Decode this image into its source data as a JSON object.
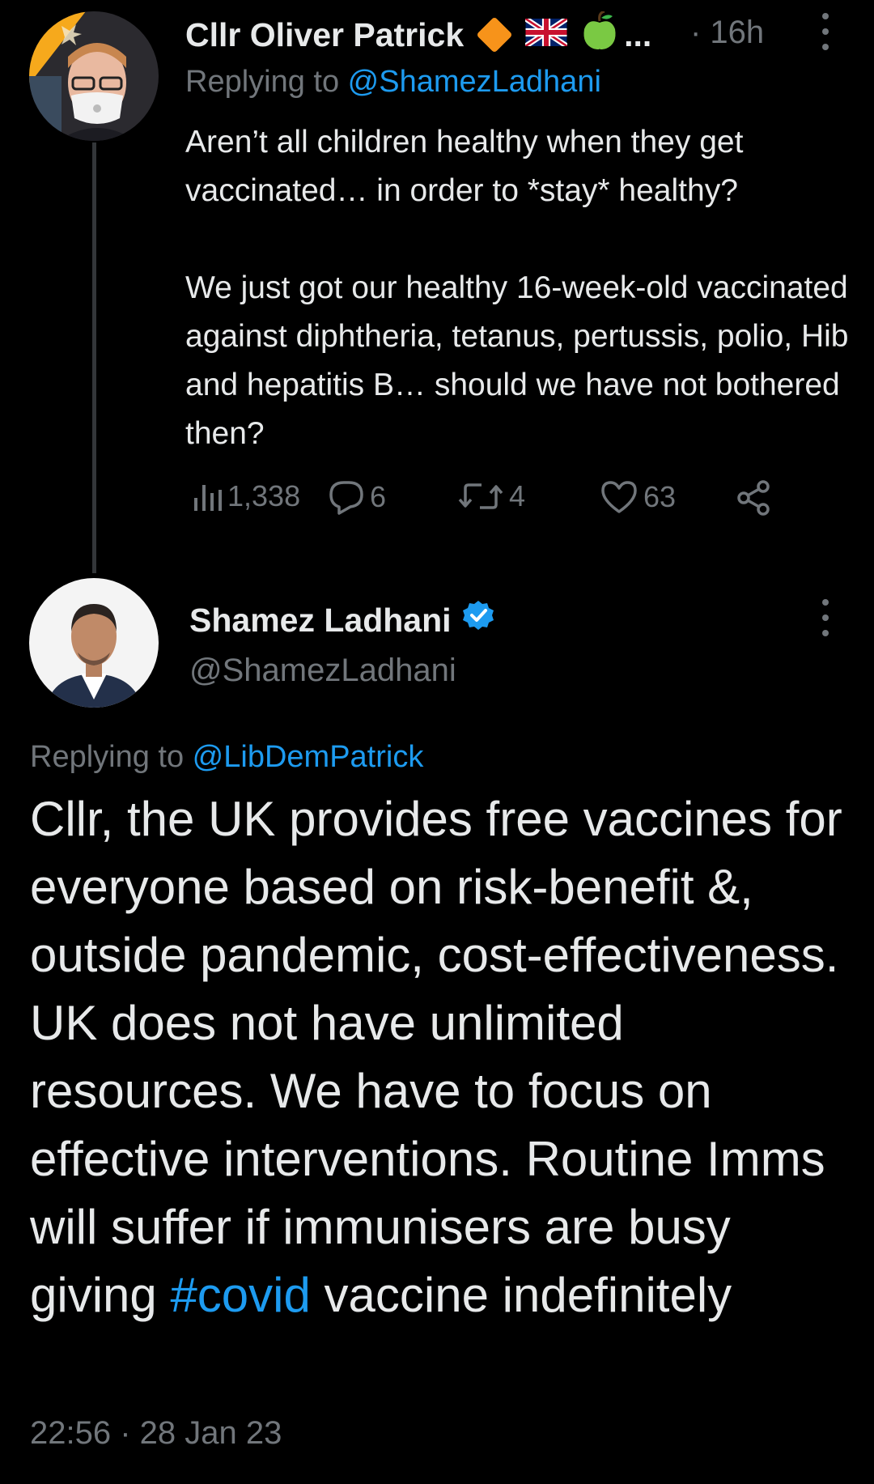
{
  "reply_tweet": {
    "author_name": "Cllr Oliver Patrick",
    "overflow_ellipsis": "...",
    "time": "· 16h",
    "replying_prefix": "Replying to ",
    "replying_handle": "@ShamezLadhani",
    "body_paragraph_1": "Aren’t all children healthy when they get vaccinated… in order to *stay* healthy?",
    "body_paragraph_2": "We just got our healthy 16-week-old vaccinated against diphtheria, tetanus, pertussis, polio, Hib and hepatitis B… should we have not bothered then?",
    "stats": {
      "views": "1,338",
      "replies": "6",
      "retweets": "4",
      "likes": "63"
    },
    "badges": [
      "orange-diamond-icon",
      "union-jack-flag-icon",
      "green-apple-icon"
    ]
  },
  "main_tweet": {
    "author_name": "Shamez Ladhani",
    "handle": "@ShamezLadhani",
    "replying_prefix": "Replying to ",
    "replying_handle": "@LibDemPatrick",
    "body_before_hashtag": "Cllr, the UK provides free vaccines for everyone based on risk-benefit &, outside pandemic, cost-effectiveness. UK does not have unlimited resources. We have to focus on effective interventions. Routine Imms will suffer if immunisers are busy giving ",
    "hashtag": "#covid",
    "body_after_hashtag": " vaccine indefinitely",
    "timestamp": "22:56 · 28 Jan 23"
  },
  "colors": {
    "background": "#000000",
    "text": "#e7e9ea",
    "secondary": "#71767b",
    "link": "#1d9bf0",
    "thread_line": "#333639"
  }
}
